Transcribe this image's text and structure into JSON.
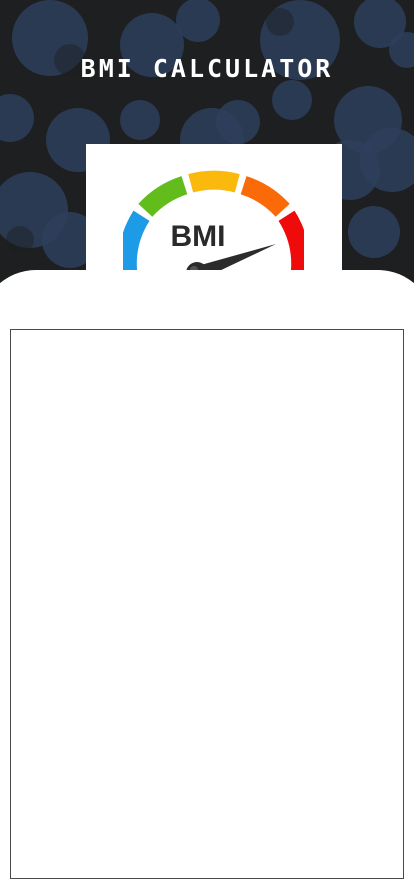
{
  "app": {
    "title": "BMI CALCULATOR"
  },
  "gauge": {
    "label": "BMI",
    "segment_colors": [
      "#1e9be6",
      "#62bd1c",
      "#fbb90e",
      "#fb6a08",
      "#ef0b0b"
    ],
    "needle_color": "#2c2c2c"
  },
  "colors": {
    "header_background": "#1d1f20",
    "pattern_circle": "#2e3f5d",
    "content_border": "#4a4a4a"
  },
  "content": {
    "items": []
  }
}
